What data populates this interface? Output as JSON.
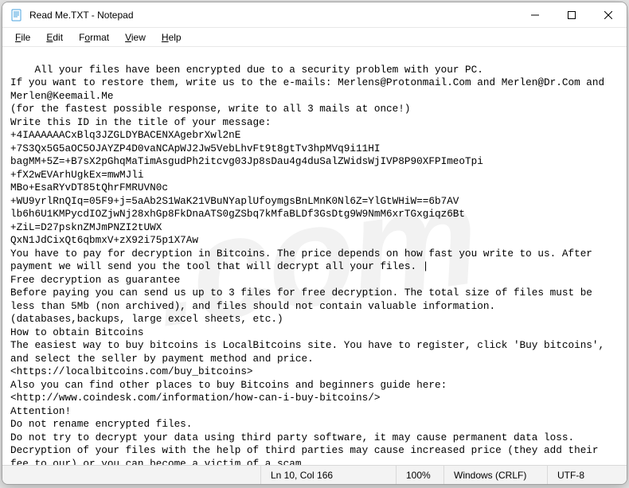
{
  "window": {
    "title": "Read Me.TXT - Notepad"
  },
  "menu": {
    "file": "File",
    "edit": "Edit",
    "format": "Format",
    "view": "View",
    "help": "Help"
  },
  "content": "All your files have been encrypted due to a security problem with your PC.\nIf you want to restore them, write us to the e-mails: Merlens@Protonmail.Com and Merlen@Dr.Com and Merlen@Keemail.Me\n(for the fastest possible response, write to all 3 mails at once!)\nWrite this ID in the title of your message:\n+4IAAAAAACxBlq3JZGLDYBACENXAgebrXwl2nE\n+7S3Qx5G5aOC5OJAYZP4D0vaNCApWJ2Jw5VebLhvFt9t8gtTv3hpMVq9i11HI\nbagMM+5Z=+B7sX2pGhqMaTimAsgudPh2itcvg03Jp8sDau4g4duSalZWidsWjIVP8P90XFPImeoTpi\n+fX2wEVArhUgkEx=mwMJli\nMBo+EsaRYvDT85tQhrFMRUVN0c\n+WU9yrlRnQIq=05F9+j=5aAb2S1WaK21VBuNYaplUfoymgsBnLMnK0Nl6Z=YlGtWHiW==6b7AV\nlb6h6U1KMPycdIOZjwNj28xhGp8FkDnaATS0gZSbq7kMfaBLDf3GsDtg9W9NmM6xrTGxgiqz6Bt\n+ZiL=D27psknZMJmPNZI2tUWX\nQxN1JdCixQt6qbmxV+zX92i75p1X7Aw\nYou have to pay for decryption in Bitcoins. The price depends on how fast you write to us. After payment we will send you the tool that will decrypt all your files. |\nFree decryption as guarantee\nBefore paying you can send us up to 3 files for free decryption. The total size of files must be less than 5Mb (non archived), and files should not contain valuable information.\n(databases,backups, large excel sheets, etc.)\nHow to obtain Bitcoins\nThe easiest way to buy bitcoins is LocalBitcoins site. You have to register, click 'Buy bitcoins', and select the seller by payment method and price.\n<https://localbitcoins.com/buy_bitcoins>\nAlso you can find other places to buy Bitcoins and beginners guide here:\n<http://www.coindesk.com/information/how-can-i-buy-bitcoins/>\nAttention!\nDo not rename encrypted files.\nDo not try to decrypt your data using third party software, it may cause permanent data loss.\nDecryption of your files with the help of third parties may cause increased price (they add their fee to our) or you can become a victim of a scam.",
  "status": {
    "position": "Ln 10, Col 166",
    "zoom": "100%",
    "eol": "Windows (CRLF)",
    "encoding": "UTF-8"
  },
  "watermark": ".com"
}
